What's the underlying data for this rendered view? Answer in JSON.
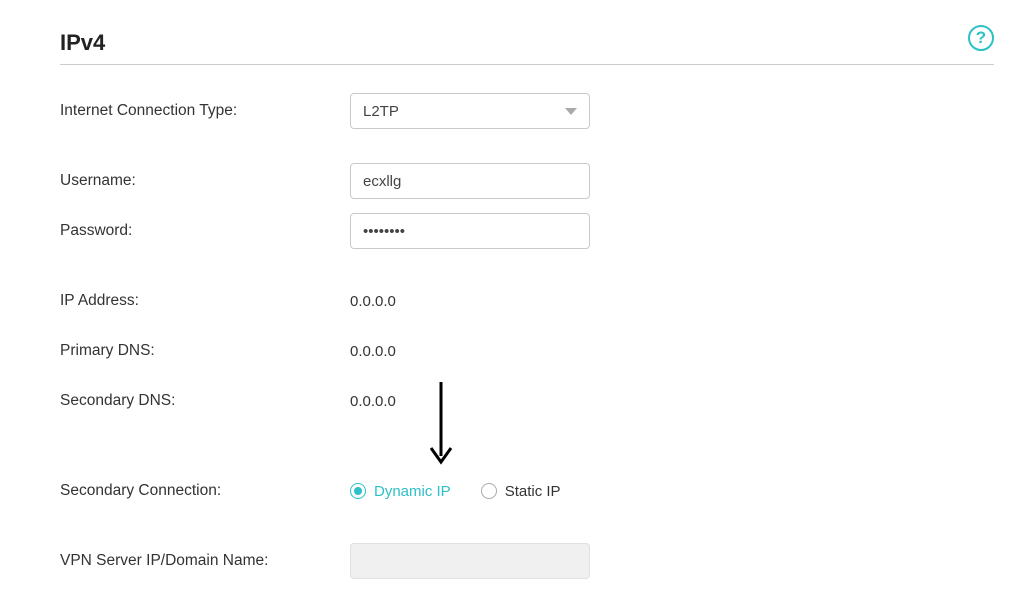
{
  "header": {
    "title": "IPv4",
    "help_glyph": "?"
  },
  "fields": {
    "connection_type": {
      "label": "Internet Connection Type:",
      "value": "L2TP"
    },
    "username": {
      "label": "Username:",
      "value": "ecxllg"
    },
    "password": {
      "label": "Password:",
      "value": "••••••••"
    },
    "ip_address": {
      "label": "IP Address:",
      "value": "0.0.0.0"
    },
    "primary_dns": {
      "label": "Primary DNS:",
      "value": "0.0.0.0"
    },
    "secondary_dns": {
      "label": "Secondary DNS:",
      "value": "0.0.0.0"
    },
    "secondary_connection": {
      "label": "Secondary Connection:",
      "options": {
        "dynamic": "Dynamic IP",
        "static": "Static IP"
      }
    },
    "vpn_server": {
      "label": "VPN Server IP/Domain Name:",
      "value": ""
    }
  }
}
